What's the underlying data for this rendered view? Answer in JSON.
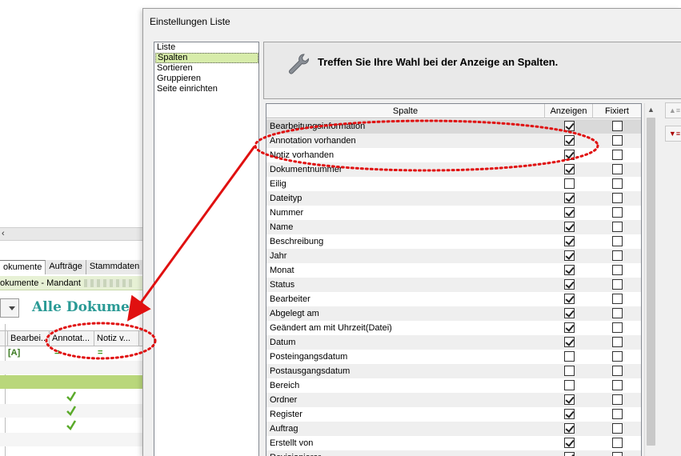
{
  "background_app": {
    "tabs": [
      {
        "label": "okumente",
        "active": true
      },
      {
        "label": "Aufträge",
        "active": false
      },
      {
        "label": "Stammdaten",
        "active": false
      },
      {
        "label": "F",
        "active": false
      }
    ],
    "breadcrumb": "okumente - Mandant",
    "view_title": "Alle Dokumente",
    "columns": [
      "Bearbei...",
      "Annotat...",
      "Notiz v..."
    ],
    "first_row_badge": "[A]",
    "first_row_annotation": "=",
    "first_row_note": "="
  },
  "dialog": {
    "title": "Einstellungen Liste",
    "nav_items": [
      {
        "label": "Liste",
        "selected": false
      },
      {
        "label": "Spalten",
        "selected": true
      },
      {
        "label": "Sortieren",
        "selected": false
      },
      {
        "label": "Gruppieren",
        "selected": false
      },
      {
        "label": "Seite einrichten",
        "selected": false
      }
    ],
    "header_text": "Treffen Sie Ihre Wahl bei der Anzeige an Spalten.",
    "grid": {
      "col_column": "Spalte",
      "col_show": "Anzeigen",
      "col_fixed": "Fixiert",
      "rows": [
        {
          "name": "Bearbeitungsinformation",
          "show": true,
          "fixed": false
        },
        {
          "name": "Annotation vorhanden",
          "show": true,
          "fixed": false
        },
        {
          "name": "Notiz vorhanden",
          "show": true,
          "fixed": false
        },
        {
          "name": "Dokumentnummer",
          "show": true,
          "fixed": false
        },
        {
          "name": "Eilig",
          "show": false,
          "fixed": false
        },
        {
          "name": "Dateityp",
          "show": true,
          "fixed": false
        },
        {
          "name": "Nummer",
          "show": true,
          "fixed": false
        },
        {
          "name": "Name",
          "show": true,
          "fixed": false
        },
        {
          "name": "Beschreibung",
          "show": true,
          "fixed": false
        },
        {
          "name": "Jahr",
          "show": true,
          "fixed": false
        },
        {
          "name": "Monat",
          "show": true,
          "fixed": false
        },
        {
          "name": "Status",
          "show": true,
          "fixed": false
        },
        {
          "name": "Bearbeiter",
          "show": true,
          "fixed": false
        },
        {
          "name": "Abgelegt am",
          "show": true,
          "fixed": false
        },
        {
          "name": "Geändert am mit Uhrzeit(Datei)",
          "show": true,
          "fixed": false
        },
        {
          "name": "Datum",
          "show": true,
          "fixed": false
        },
        {
          "name": "Posteingangsdatum",
          "show": false,
          "fixed": false
        },
        {
          "name": "Postausgangsdatum",
          "show": false,
          "fixed": false
        },
        {
          "name": "Bereich",
          "show": false,
          "fixed": false
        },
        {
          "name": "Ordner",
          "show": true,
          "fixed": false
        },
        {
          "name": "Register",
          "show": true,
          "fixed": false
        },
        {
          "name": "Auftrag",
          "show": true,
          "fixed": false
        },
        {
          "name": "Erstellt von",
          "show": true,
          "fixed": false
        },
        {
          "name": "Revisionierer",
          "show": true,
          "fixed": false
        }
      ]
    }
  },
  "colors": {
    "annotation_red": "#e01010",
    "nav_selected": "#d7ecaa",
    "title_teal": "#2a9a95",
    "check_green": "#5aaa2a"
  }
}
